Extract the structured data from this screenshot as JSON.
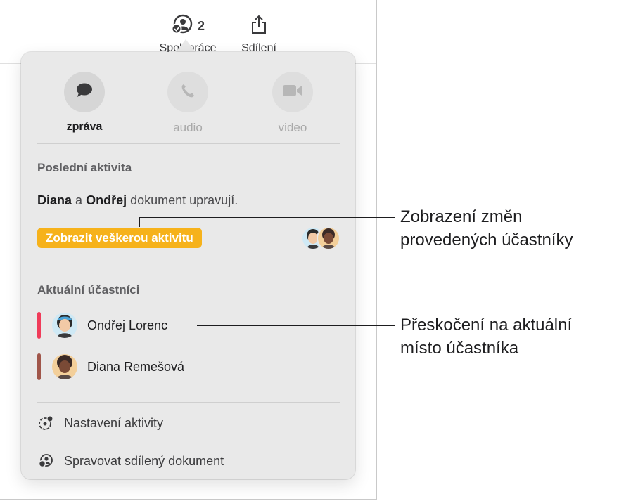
{
  "toolbar": {
    "collaborate_count": "2",
    "collaborate_label": "Spolupráce",
    "share_label": "Sdílení"
  },
  "popover": {
    "comm_buttons": [
      {
        "icon": "message-bubble-icon",
        "label": "zpráva",
        "enabled": true
      },
      {
        "icon": "phone-icon",
        "label": "audio",
        "enabled": false
      },
      {
        "icon": "video-camera-icon",
        "label": "video",
        "enabled": false
      }
    ],
    "recent_activity": {
      "title": "Poslední aktivita",
      "name1": "Diana",
      "conj": "a",
      "name2": "Ondřej",
      "suffix": "dokument upravují.",
      "button_label": "Zobrazit veškerou aktivitu"
    },
    "participants": {
      "title": "Aktuální účastníci",
      "items": [
        {
          "name": "Ondřej Lorenc",
          "color": "#f03c5a",
          "avatar_bg": "#cfe9f5"
        },
        {
          "name": "Diana Remešová",
          "color": "#a0564a",
          "avatar_bg": "#f3cf9a"
        }
      ]
    },
    "menu": [
      {
        "icon": "activity-settings-icon",
        "label": "Nastavení aktivity"
      },
      {
        "icon": "manage-shared-icon",
        "label": "Spravovat sdílený dokument"
      }
    ]
  },
  "callouts": {
    "activity": "Zobrazení změn provedených účastníky",
    "activity_line1": "Zobrazení změn",
    "activity_line2": "provedených účastníky",
    "jump_line1": "Přeskočení na aktuální",
    "jump_line2": "místo účastníka"
  },
  "colors": {
    "accent_yellow": "#f6b21b",
    "popover_bg": "#e9e9e9"
  }
}
